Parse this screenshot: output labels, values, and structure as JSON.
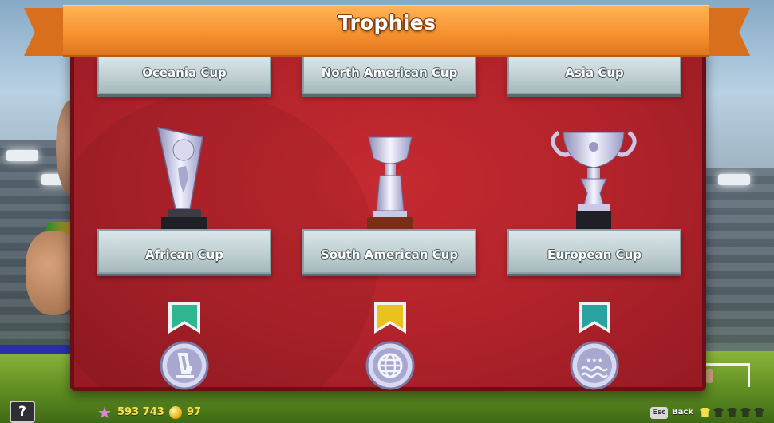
{
  "header": {
    "title": "Trophies"
  },
  "cups_top_row": [
    {
      "label": "Oceania Cup"
    },
    {
      "label": "North American Cup"
    },
    {
      "label": "Asia Cup"
    }
  ],
  "cups_main_row": [
    {
      "label": "African Cup",
      "trophy": "african-cup-trophy-icon"
    },
    {
      "label": "South American Cup",
      "trophy": "south-american-cup-trophy-icon"
    },
    {
      "label": "European Cup",
      "trophy": "european-cup-trophy-icon"
    }
  ],
  "medals": [
    {
      "icon": "microscope-medal-icon",
      "ribbon_color": "#2fb58f"
    },
    {
      "icon": "globe-medal-icon",
      "ribbon_color": "#e9c21c"
    },
    {
      "icon": "waves-stars-medal-icon",
      "ribbon_color": "#2aa3a0"
    }
  ],
  "hud": {
    "help_label": "?",
    "stars_value": "593 743",
    "coins_value": "97",
    "esc_key_label": "Esc",
    "back_label": "Back",
    "kit_colors": [
      "#f4e04b",
      "#2b3b1f",
      "#2b3b1f",
      "#2b3b1f",
      "#2b3b1f"
    ]
  },
  "colors": {
    "ribbon": "#f7922f",
    "panel": "#b0222b",
    "plate": "#bfcfd2"
  }
}
